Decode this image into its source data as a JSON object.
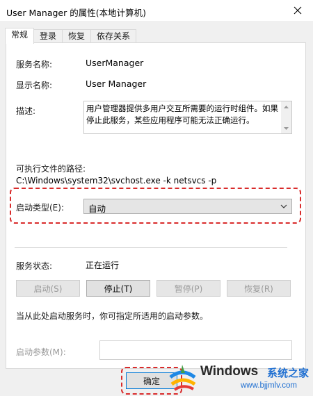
{
  "window": {
    "title": "User Manager 的属性(本地计算机)"
  },
  "tabs": [
    {
      "label": "常规",
      "active": true
    },
    {
      "label": "登录",
      "active": false
    },
    {
      "label": "恢复",
      "active": false
    },
    {
      "label": "依存关系",
      "active": false
    }
  ],
  "general": {
    "service_name_label": "服务名称:",
    "service_name_value": "UserManager",
    "display_name_label": "显示名称:",
    "display_name_value": "User Manager",
    "description_label": "描述:",
    "description_value": "用户管理器提供多用户交互所需要的运行时组件。如果停止此服务，某些应用程序可能无法正确运行。",
    "path_label": "可执行文件的路径:",
    "path_value": "C:\\Windows\\system32\\svchost.exe -k netsvcs -p",
    "startup_type_label": "启动类型(E):",
    "startup_type_value": "自动",
    "status_label": "服务状态:",
    "status_value": "正在运行",
    "buttons": {
      "start": "启动(S)",
      "stop": "停止(T)",
      "pause": "暂停(P)",
      "resume": "恢复(R)"
    },
    "hint": "当从此处启动服务时，你可指定所适用的启动参数。",
    "params_label": "启动参数(M):",
    "params_value": ""
  },
  "footer": {
    "ok_label": "确定"
  },
  "watermark": {
    "brand": "Windows",
    "site_cn": "系统之家",
    "url": "www.bjjmlv.com"
  },
  "colors": {
    "highlight": "#d92b2b",
    "focus_border": "#0078d7",
    "watermark_blue": "#1f6fd1"
  }
}
